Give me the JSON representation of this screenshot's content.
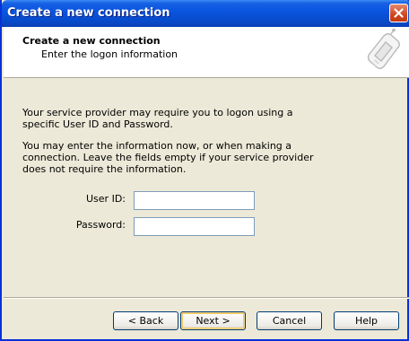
{
  "window": {
    "title": "Create a new connection"
  },
  "header": {
    "title": "Create a new connection",
    "subtitle": "Enter the logon information",
    "icon": "phone-icon"
  },
  "body": {
    "paragraph1": "Your service provider may require you to logon using a specific User ID and Password.",
    "paragraph2": "You may enter the information now, or when making a connection. Leave the fields empty if your service provider does not require the information."
  },
  "form": {
    "user_id_label": "User ID:",
    "user_id_value": "",
    "password_label": "Password:",
    "password_value": ""
  },
  "buttons": {
    "back": "< Back",
    "next": "Next >",
    "cancel": "Cancel",
    "help": "Help"
  },
  "colors": {
    "titlebar": "#0a55e0",
    "face": "#ece9d8",
    "close": "#d0461e"
  }
}
